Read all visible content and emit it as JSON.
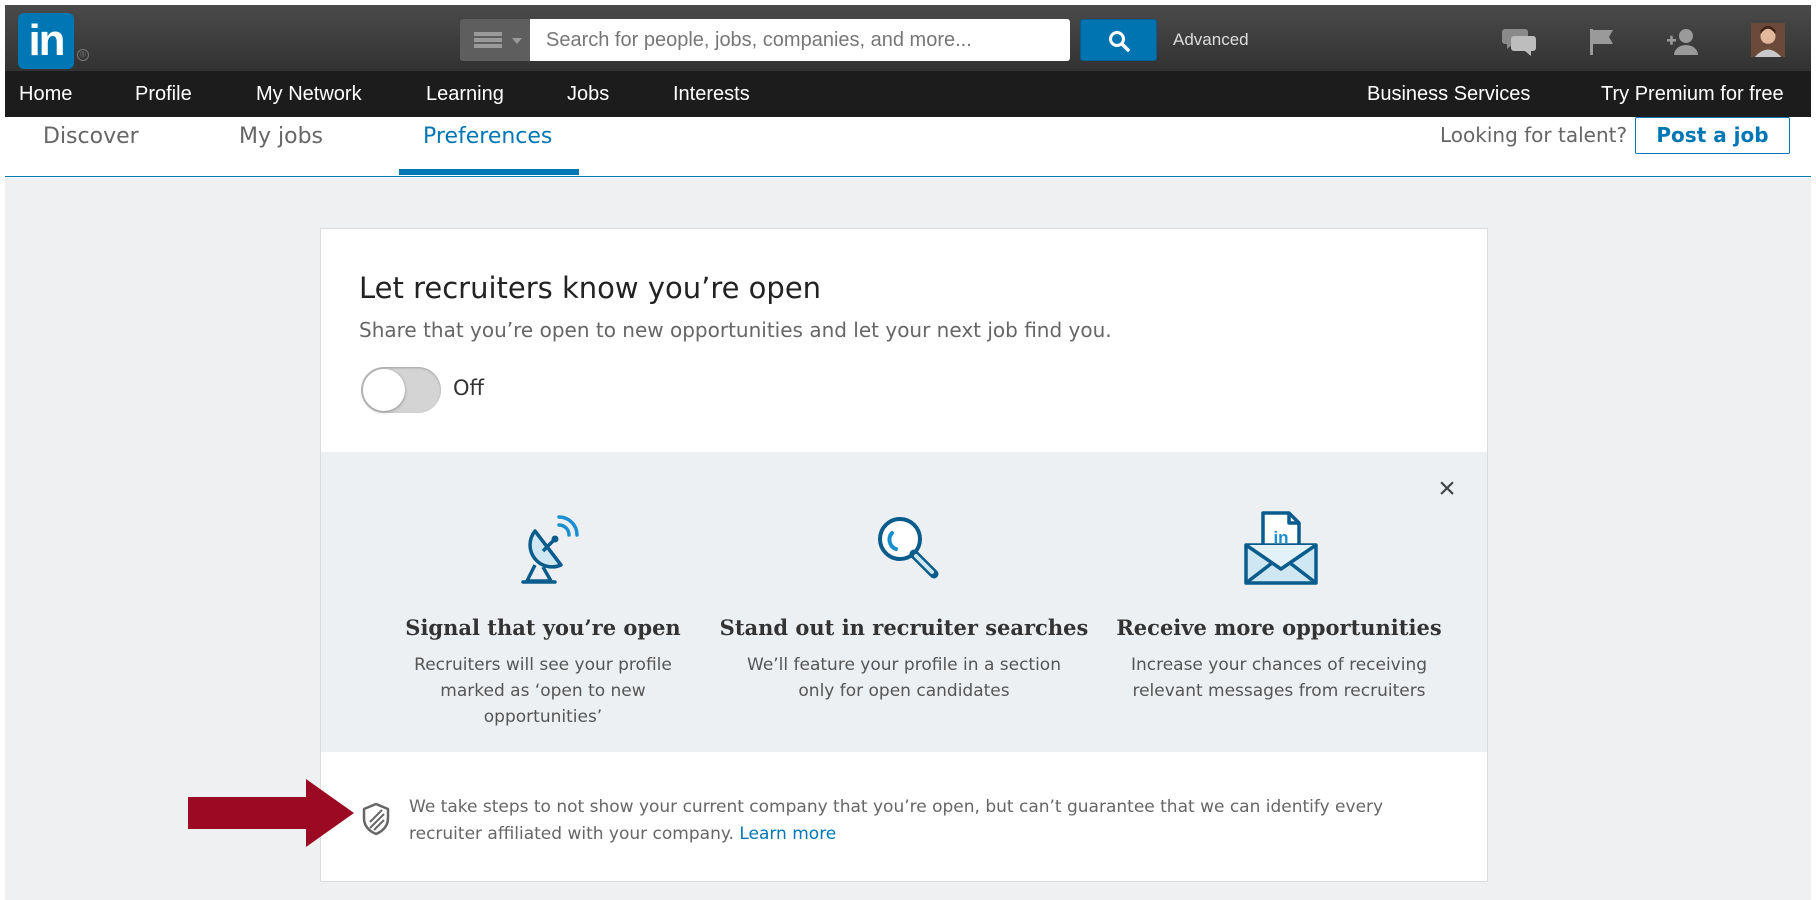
{
  "header": {
    "logo_text": "in",
    "logo_reg": "®",
    "search": {
      "placeholder": "Search for people, jobs, companies, and more..."
    },
    "advanced_label": "Advanced",
    "icons": [
      "messages-icon",
      "notifications-flag-icon",
      "add-connections-icon",
      "avatar"
    ]
  },
  "nav": {
    "items": [
      "Home",
      "Profile",
      "My Network",
      "Learning",
      "Jobs",
      "Interests"
    ],
    "right": {
      "business": "Business Services",
      "premium": "Try Premium for free"
    }
  },
  "jobs_tabs": {
    "tabs": [
      {
        "label": "Discover"
      },
      {
        "label": "My jobs"
      },
      {
        "label": "Preferences",
        "active": true
      }
    ],
    "talent_text": "Looking for talent?",
    "post_job_label": "Post a job"
  },
  "card": {
    "title": "Let recruiters know you’re open",
    "subtitle": "Share that you’re open to new opportunities and let your next job find you.",
    "toggle": {
      "state": "Off"
    },
    "close_label": "×",
    "features": [
      {
        "icon": "satellite-dish-icon",
        "title": "Signal that you’re open",
        "desc": "Recruiters will see your profile marked as ‘open to new opportunities’"
      },
      {
        "icon": "magnifier-icon",
        "title": "Stand out in recruiter searches",
        "desc": "We’ll feature your profile in a section only for open candidates"
      },
      {
        "icon": "envelope-document-icon",
        "badge": "in",
        "title": "Receive more opportunities",
        "desc": "Increase your chances of receiving relevant messages from recruiters"
      }
    ],
    "notice": {
      "text": "We take steps to not show your current company that you’re open, but can’t guarantee that we can identify every recruiter affiliated with your company.",
      "link": "Learn more"
    }
  },
  "colors": {
    "brand_blue": "#0077b5",
    "topbar": "#3c3c3c",
    "navbar": "#1c1c1c",
    "page_bg": "#eef0f2",
    "annotation_arrow": "#9b0a22"
  }
}
